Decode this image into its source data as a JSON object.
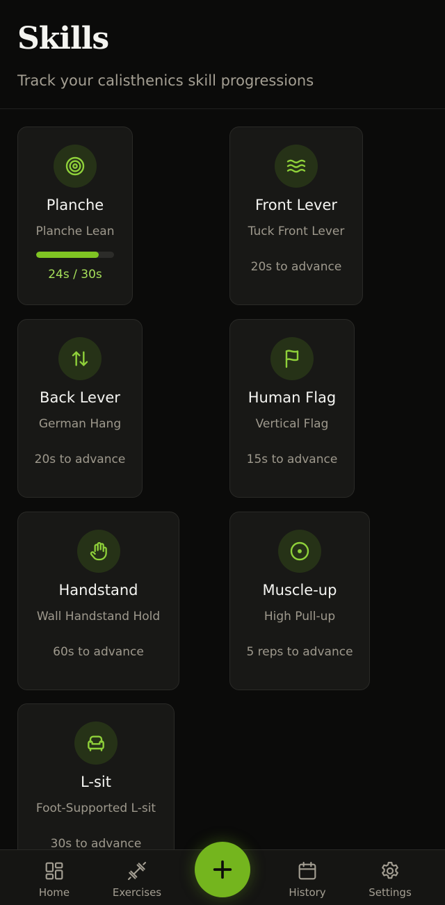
{
  "header": {
    "title": "Skills",
    "subtitle": "Track your calisthenics skill progressions"
  },
  "colors": {
    "accent": "#7fc423",
    "background": "#0b0b0a",
    "card": "#181816",
    "icon_bg": "#263217",
    "muted_text": "#9e998d"
  },
  "skills": [
    {
      "name": "Planche",
      "level": "Planche Lean",
      "icon": "target-icon",
      "progress_text": "24s / 30s",
      "progress": 0.8
    },
    {
      "name": "Front Lever",
      "level": "Tuck Front Lever",
      "icon": "waves-icon",
      "advance": "20s to advance"
    },
    {
      "name": "Back Lever",
      "level": "German Hang",
      "icon": "arrows-up-down-icon",
      "advance": "20s to advance"
    },
    {
      "name": "Human Flag",
      "level": "Vertical Flag",
      "icon": "flag-icon",
      "advance": "15s to advance"
    },
    {
      "name": "Handstand",
      "level": "Wall Handstand Hold",
      "icon": "hand-icon",
      "advance": "60s to advance"
    },
    {
      "name": "Muscle-up",
      "level": "High Pull-up",
      "icon": "circle-dot-icon",
      "advance": "5 reps to advance"
    },
    {
      "name": "L-sit",
      "level": "Foot-Supported L-sit",
      "icon": "armchair-icon",
      "advance": "30s to advance"
    }
  ],
  "nav": {
    "home": "Home",
    "exercises": "Exercises",
    "add_icon": "plus-icon",
    "history": "History",
    "settings": "Settings"
  }
}
